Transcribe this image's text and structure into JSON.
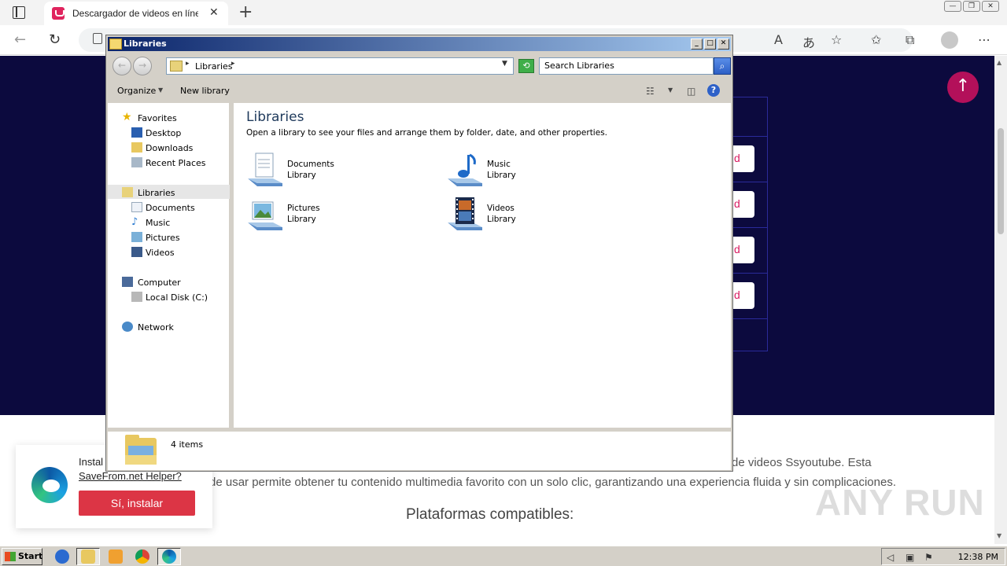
{
  "browser": {
    "tab_title": "Descargador de videos en línea",
    "tab_close": "✕",
    "new_tab": "+",
    "toolbar_icons": [
      "read-aloud-icon",
      "translate-icon",
      "add-favorite-icon",
      "favorites-icon",
      "collections-icon",
      "profile-icon",
      "more-icon"
    ]
  },
  "webpage": {
    "download_btn_label": "d",
    "text_line1": "de videos Ssyoutube. Esta",
    "text_line2": "de usar permite obtener tu contenido multimedia favorito con un solo clic, garantizando una experiencia fluida y sin complicaciones.",
    "heading": "Plataformas compatibles:",
    "watermark": "ANY RUN",
    "popup": {
      "text": "Instal",
      "link": "SaveFrom.net Helper?",
      "button": "Sí, instalar"
    }
  },
  "explorer": {
    "title": "Libraries",
    "address": "Libraries",
    "search_placeholder": "Search Libraries",
    "commands": {
      "organize": "Organize",
      "new_library": "New library"
    },
    "nav": {
      "favorites": "Favorites",
      "desktop": "Desktop",
      "downloads": "Downloads",
      "recent": "Recent Places",
      "libraries": "Libraries",
      "documents": "Documents",
      "music": "Music",
      "pictures": "Pictures",
      "videos": "Videos",
      "computer": "Computer",
      "local_disk": "Local Disk (C:)",
      "network": "Network"
    },
    "content": {
      "heading": "Libraries",
      "description": "Open a library to see your files and arrange them by folder, date, and other properties.",
      "libraries": [
        {
          "name": "Documents",
          "type": "Library"
        },
        {
          "name": "Music",
          "type": "Library"
        },
        {
          "name": "Pictures",
          "type": "Library"
        },
        {
          "name": "Videos",
          "type": "Library"
        }
      ]
    },
    "status": "4 items"
  },
  "taskbar": {
    "start": "Start",
    "clock": "12:38 PM"
  }
}
